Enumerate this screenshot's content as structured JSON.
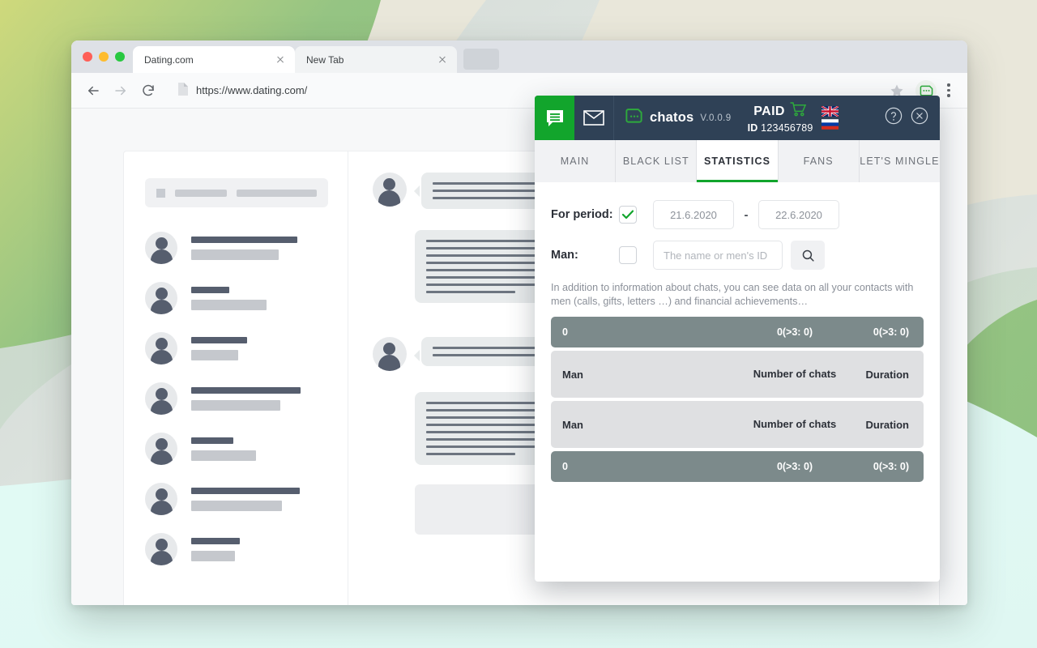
{
  "browser": {
    "tabs": [
      {
        "title": "Dating.com",
        "active": true,
        "close_icon": "close-icon"
      },
      {
        "title": "New Tab",
        "active": false,
        "close_icon": "close-icon"
      }
    ],
    "url": "https://www.dating.com/",
    "nav": {
      "back_icon": "arrow-left-icon",
      "forward_icon": "arrow-right-icon",
      "reload_icon": "reload-icon",
      "page_icon": "page-file-icon",
      "bookmark_icon": "star-icon",
      "extension_icon": "chatos-extension-icon",
      "menu_icon": "kebab-menu-icon"
    }
  },
  "panel": {
    "header": {
      "chat_icon": "chat-bubble-icon",
      "mail_icon": "envelope-icon",
      "logo_icon": "chatos-logo-icon",
      "brand": "chatos",
      "version": "V.0.0.9",
      "paid_label": "PAID",
      "cart_icon": "cart-icon",
      "id_prefix": "ID",
      "id_value": "123456789",
      "flag_en": "flag-uk-icon",
      "flag_ru": "flag-russia-icon",
      "help_icon": "question-circle-icon",
      "close_icon": "close-circle-icon"
    },
    "tabs": [
      {
        "label": "MAIN",
        "active": false
      },
      {
        "label": "BLACK LIST",
        "active": false
      },
      {
        "label": "STATISTICS",
        "active": true
      },
      {
        "label": "FANS",
        "active": false
      },
      {
        "label": "LET'S MINGLE",
        "active": false
      }
    ],
    "filters": {
      "period_label": "For period:",
      "period_checked": true,
      "date_from": "21.6.2020",
      "date_to": "22.6.2020",
      "date_separator": "-",
      "man_label": "Man:",
      "man_checked": false,
      "man_placeholder": "The name or men's ID",
      "man_value": "",
      "search_icon": "search-icon"
    },
    "note": "In addition to information about chats, you can see data on all your contacts with men (calls, gifts, letters …) and financial achievements…",
    "table": {
      "rows": [
        {
          "style": "dark",
          "c1": "0",
          "c2": "0(>3: 0)",
          "c3": "0(>3: 0)"
        },
        {
          "style": "light",
          "c1": "Man",
          "c2": "Number of chats",
          "c3": "Duration"
        },
        {
          "style": "light",
          "c1": "Man",
          "c2": "Number of chats",
          "c3": "Duration"
        },
        {
          "style": "dark",
          "c1": "0",
          "c2": "0(>3: 0)",
          "c3": "0(>3: 0)"
        }
      ]
    }
  },
  "colors": {
    "accent_green": "#12a52c",
    "header_navy": "#2f4156",
    "row_dark": "#7c8a8b",
    "row_light": "#dfe0e2"
  }
}
